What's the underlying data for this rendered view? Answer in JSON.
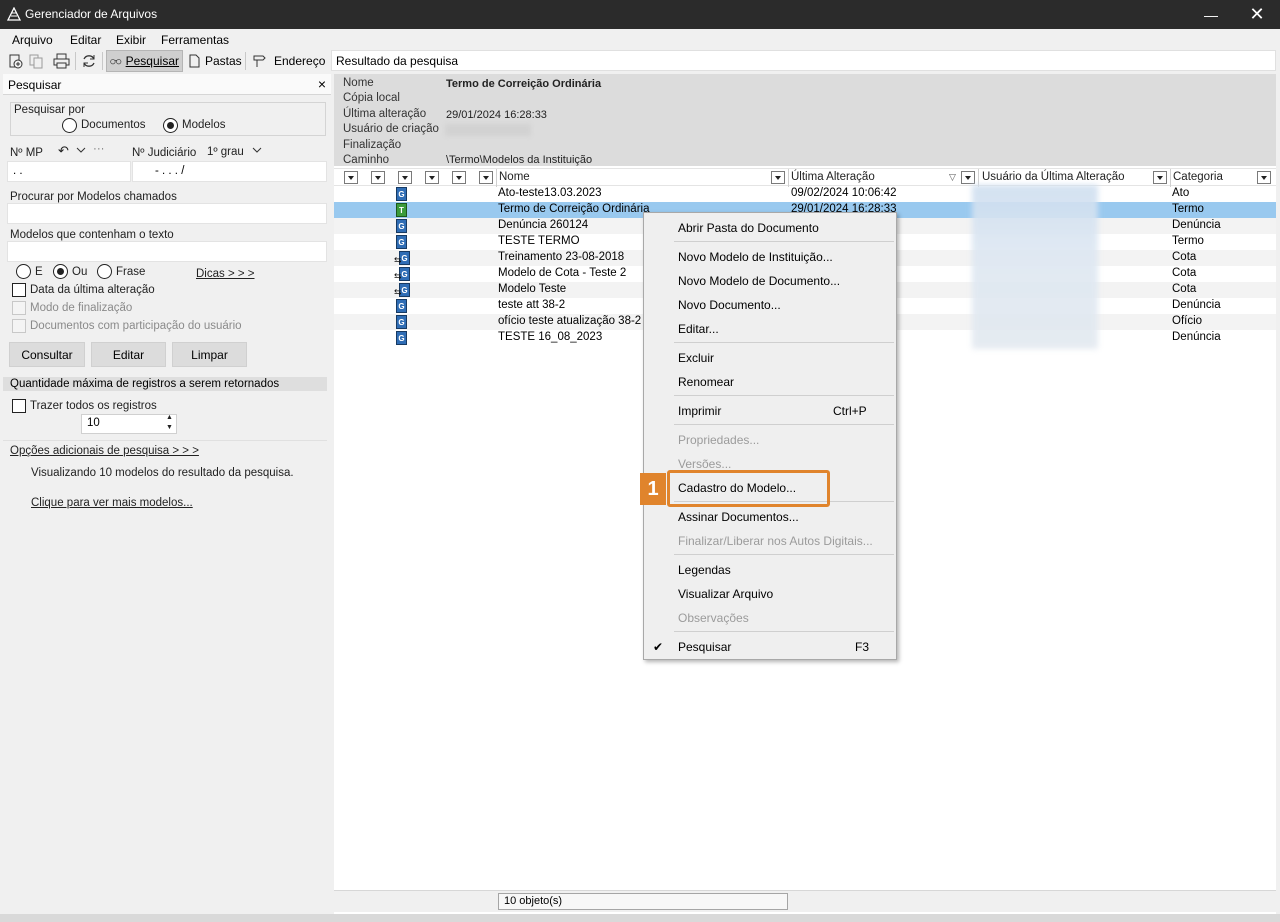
{
  "window": {
    "title": "Gerenciador de Arquivos",
    "minimize_glyph": "—",
    "close_glyph": "✕"
  },
  "menu": [
    {
      "label": "Arquivo"
    },
    {
      "label": "Editar"
    },
    {
      "label": "Exibir"
    },
    {
      "label": "Ferramentas"
    }
  ],
  "toolbar": {
    "search_label": "Pesquisar",
    "folders_label": "Pastas",
    "address_label": "Endereço",
    "address_value": "Resultado da pesquisa"
  },
  "left": {
    "header": "Pesquisar",
    "close_glyph": "×",
    "search_by_label": "Pesquisar por",
    "radio_documents": "Documentos",
    "radio_models": "Modelos",
    "mp_label": "Nº MP",
    "mp_value": ".   .",
    "judicial_label": "Nº Judiciário",
    "grau_label": "1º grau",
    "judicial_value": "-  .   .  .   /",
    "models_named_label": "Procurar por Modelos chamados",
    "models_text_label": "Modelos que contenham o texto",
    "opt_e": "E",
    "opt_ou": "Ou",
    "opt_frase": "Frase",
    "tips_link": "Dicas > > >",
    "chk_last_change": "Data da última alteração",
    "chk_final_mode": "Modo de finalização",
    "chk_participation": "Documentos com participação do usuário",
    "btn_consult": "Consultar",
    "btn_edit": "Editar",
    "btn_clear": "Limpar",
    "max_records_label": "Quantidade máxima de registros a serem retornados",
    "chk_all_records": "Trazer todos os registros",
    "max_value": "10",
    "more_options_link": "Opções adicionais de pesquisa > > >",
    "viewing_text": "Visualizando 10 modelos do resultado da pesquisa.",
    "see_more_link": "Clique para ver mais modelos..."
  },
  "props": {
    "name_label": "Nome",
    "name_value": "Termo de Correição Ordinária",
    "local_copy_label": "Cópia local",
    "last_change_label": "Última alteração",
    "last_change_value": "29/01/2024 16:28:33",
    "creator_label": "Usuário de criação",
    "finalization_label": "Finalização",
    "path_label": "Caminho",
    "path_value": "\\Termo\\Modelos da Instituição"
  },
  "columns": {
    "name": "Nome",
    "last_change": "Última Alteração",
    "last_user": "Usuário da Última Alteração",
    "category": "Categoria"
  },
  "rows": [
    {
      "icon": "G",
      "name": "Ato-teste13.03.2023",
      "date": "09/02/2024 10:06:42",
      "category": "Ato"
    },
    {
      "icon": "T",
      "name": "Termo de Correição Ordinária",
      "date": "29/01/2024 16:28:33",
      "category": "Termo"
    },
    {
      "icon": "G",
      "name": "Denúncia 260124",
      "date": "",
      "category": "Denúncia"
    },
    {
      "icon": "G",
      "name": "TESTE TERMO",
      "date": "",
      "category": "Termo"
    },
    {
      "icon": "G",
      "name": "Treinamento 23-08-2018",
      "date": "",
      "category": "Cota"
    },
    {
      "icon": "G",
      "name": "Modelo de Cota - Teste 2",
      "date": "",
      "category": "Cota"
    },
    {
      "icon": "G",
      "name": "Modelo Teste",
      "date": "",
      "category": "Cota"
    },
    {
      "icon": "G",
      "name": "teste att 38-2",
      "date": "",
      "category": "Denúncia"
    },
    {
      "icon": "G",
      "name": "ofício teste atualização 38-2 1",
      "date": "",
      "category": "Ofício"
    },
    {
      "icon": "G",
      "name": "TESTE 16_08_2023",
      "date": "",
      "category": "Denúncia"
    }
  ],
  "status": {
    "count": "10 objeto(s)"
  },
  "context_menu": {
    "open_folder": "Abrir Pasta do Documento",
    "new_inst_model": "Novo Modelo de Instituição...",
    "new_doc_model": "Novo Modelo de Documento...",
    "new_doc": "Novo Documento...",
    "edit": "Editar...",
    "delete": "Excluir",
    "rename": "Renomear",
    "print": "Imprimir",
    "print_shortcut": "Ctrl+P",
    "properties": "Propriedades...",
    "versions": "Versões...",
    "model_register": "Cadastro do Modelo...",
    "sign_docs": "Assinar Documentos...",
    "finalize": "Finalizar/Liberar nos Autos Digitais...",
    "legends": "Legendas",
    "view_file": "Visualizar Arquivo",
    "notes": "Observações",
    "search": "Pesquisar",
    "search_shortcut": "F3",
    "check_glyph": "✔"
  },
  "callout": {
    "number": "1",
    "color": "#e0842c"
  },
  "colors": {
    "selection": "#99c9ef",
    "titlebar": "#2b2b2b"
  }
}
